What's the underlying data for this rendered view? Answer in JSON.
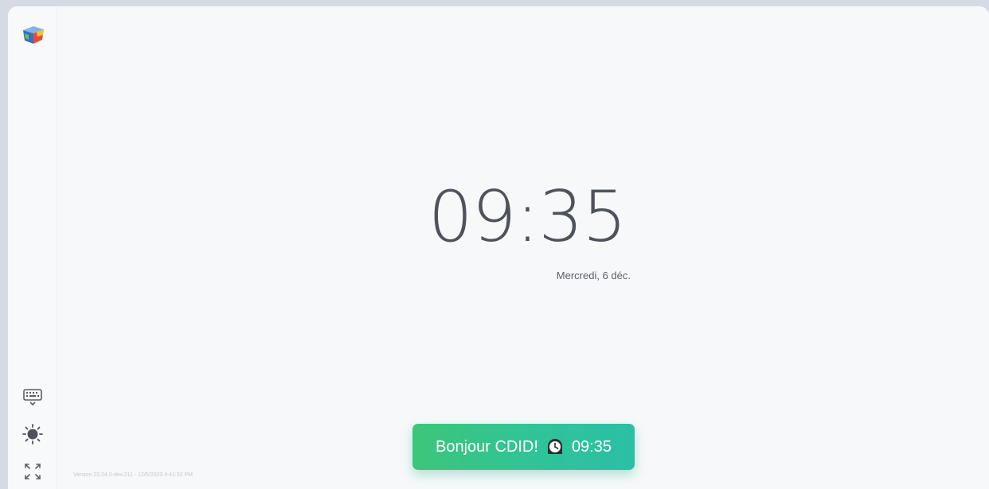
{
  "clock": {
    "time": "09:35",
    "date": "Mercredi, 6 déc."
  },
  "greeting": {
    "text": "Bonjour CDID!",
    "time": "09:35",
    "icon": "clock-icon"
  },
  "footer": {
    "version": "Version 23.24.0-dev.211 - 12/5/2023 4:41:32 PM"
  },
  "sidebar": {
    "logo_icon": "cube-logo-icon",
    "tools": [
      {
        "icon": "keyboard-icon"
      },
      {
        "icon": "brightness-icon"
      },
      {
        "icon": "fullscreen-icon"
      }
    ]
  },
  "colors": {
    "greeting_start": "#3cc67a",
    "greeting_end": "#2bbfa6",
    "clock_text": "#4e535b",
    "background": "#f7f8fa"
  }
}
